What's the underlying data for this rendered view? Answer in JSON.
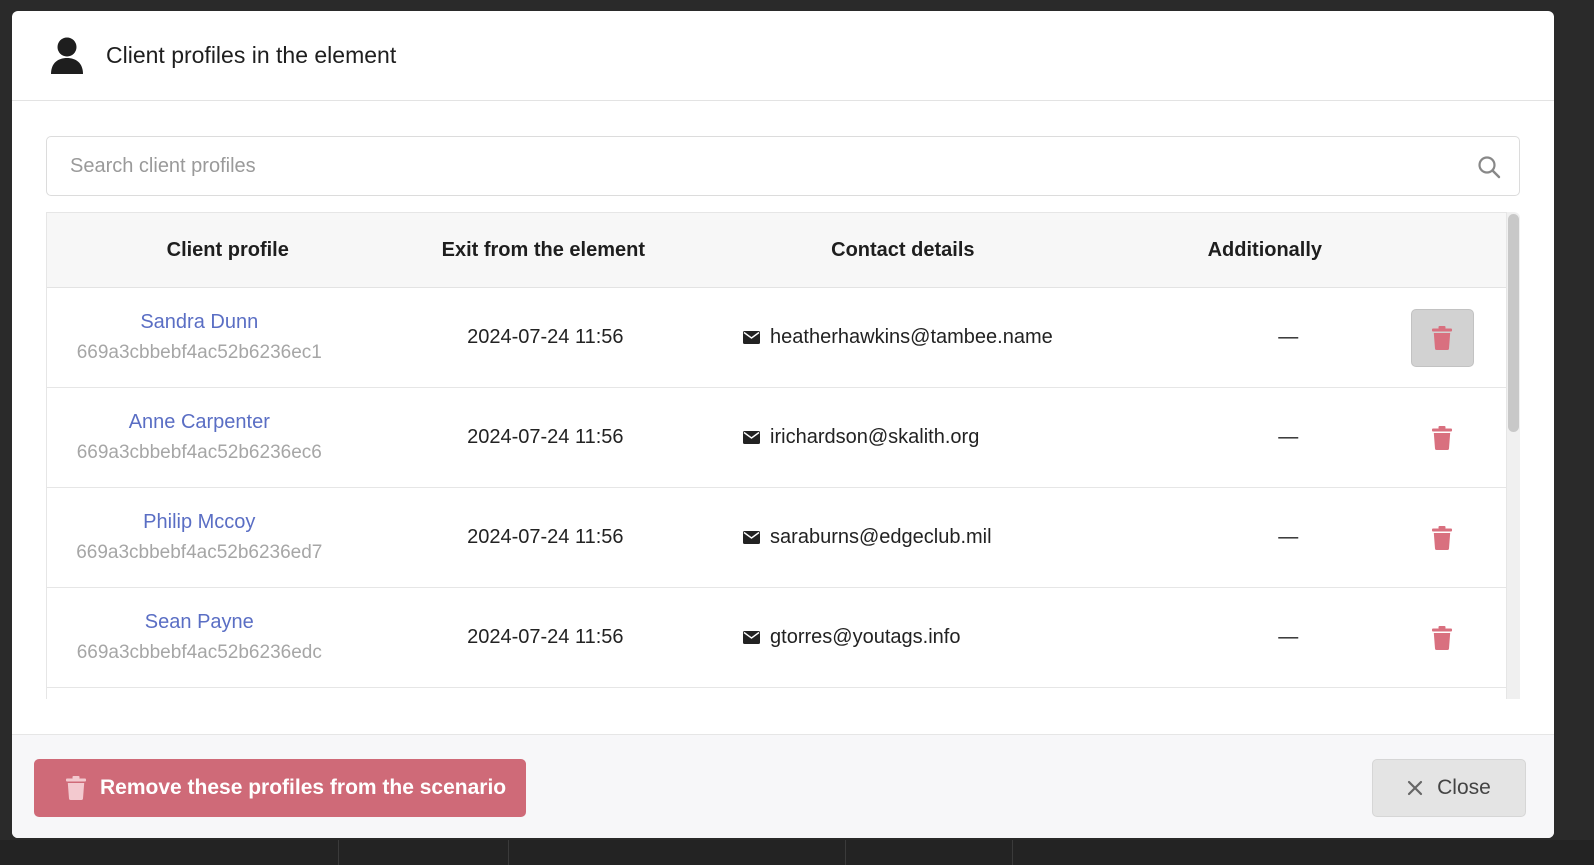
{
  "modal": {
    "title": "Client profiles in the element",
    "search_placeholder": "Search client profiles"
  },
  "table": {
    "headers": [
      "Client profile",
      "Exit from the element",
      "Contact details",
      "Additionally"
    ],
    "rows": [
      {
        "name": "Sandra Dunn",
        "id": "669a3cbbebf4ac52b6236ec1",
        "exit": "2024-07-24 11:56",
        "email": "heatherhawkins@tambee.name",
        "additionally": "—"
      },
      {
        "name": "Anne Carpenter",
        "id": "669a3cbbebf4ac52b6236ec6",
        "exit": "2024-07-24 11:56",
        "email": "irichardson@skalith.org",
        "additionally": "—"
      },
      {
        "name": "Philip Mccoy",
        "id": "669a3cbbebf4ac52b6236ed7",
        "exit": "2024-07-24 11:56",
        "email": "saraburns@edgeclub.mil",
        "additionally": "—"
      },
      {
        "name": "Sean Payne",
        "id": "669a3cbbebf4ac52b6236edc",
        "exit": "2024-07-24 11:56",
        "email": "gtorres@youtags.info",
        "additionally": "—"
      }
    ]
  },
  "footer": {
    "remove_label": "Remove these profiles from the scenario",
    "close_label": "Close"
  },
  "colors": {
    "accent_link": "#5a6ec4",
    "danger": "#cf6a78",
    "trash_icon": "#d9707f"
  },
  "icons": [
    "user-icon",
    "search-icon",
    "mail-icon",
    "trash-icon",
    "close-icon"
  ]
}
